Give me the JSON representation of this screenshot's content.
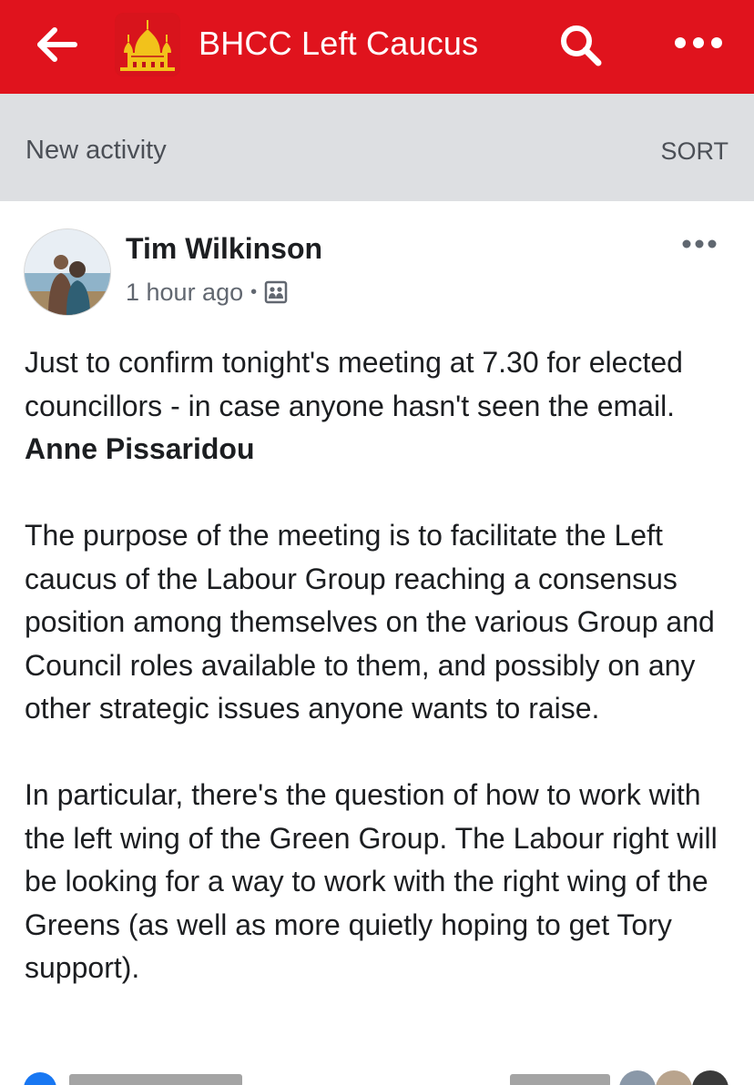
{
  "header": {
    "title": "BHCC Left Caucus",
    "back_icon": "arrow-left-icon",
    "logo_icon": "royal-pavilion-logo",
    "search_icon": "search-icon",
    "more_icon": "more-horizontal-icon",
    "color": "#e0131d"
  },
  "activity": {
    "label": "New activity",
    "sort_label": "SORT"
  },
  "post": {
    "author": "Tim Wilkinson",
    "time": "1 hour ago",
    "separator": "•",
    "audience_icon": "group-audience-icon",
    "paragraph1_text": "Just to confirm tonight's meeting at 7.30 for elected councillors - in case anyone hasn't seen the email. ",
    "mention": "Anne Pissaridou",
    "paragraph2": "The purpose of the meeting is to facilitate the Left caucus of the Labour Group reaching a consensus position among themselves on the various Group and Council roles available to them, and possibly on any other strategic issues anyone wants to raise.",
    "paragraph3": "In particular, there's the question of how to work with the left wing of the Green Group. The Labour right will be looking for a way to work with the right wing of the Greens (as well as more quietly hoping to get Tory support)."
  }
}
